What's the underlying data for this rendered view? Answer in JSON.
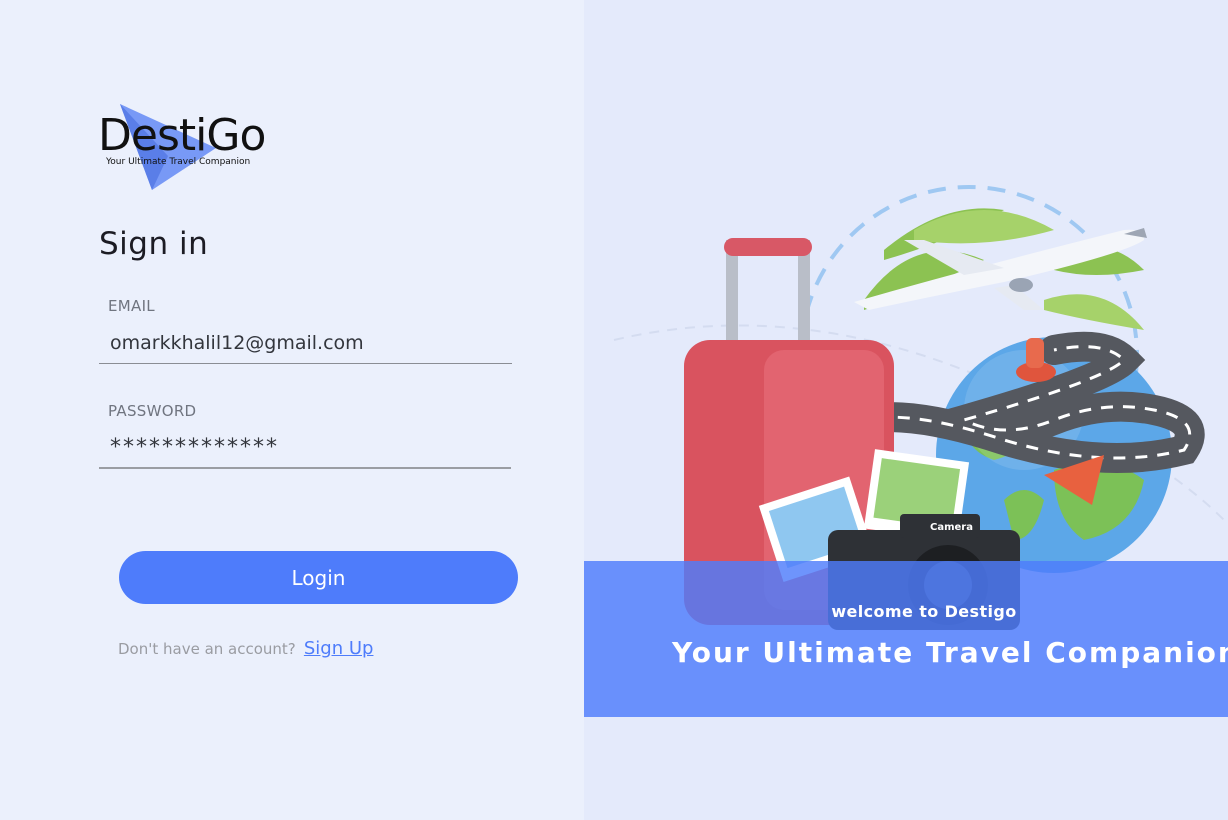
{
  "brand": {
    "name": "DestiGo",
    "tagline": "Your Ultimate Travel Companion",
    "accent_color": "#4e7cfb"
  },
  "form": {
    "title": "Sign in",
    "email_label": "EMAIL",
    "email_value": "omarkkhalil12@gmail.com",
    "password_label": "PASSWORD",
    "password_value": "*************",
    "login_label": "Login"
  },
  "signup": {
    "prompt": "Don't have an account?",
    "link_label": "Sign Up"
  },
  "hero": {
    "welcome": "welcome to Destigo",
    "tagline": "Your Ultimate Travel Companion",
    "camera_label": "Camera"
  }
}
